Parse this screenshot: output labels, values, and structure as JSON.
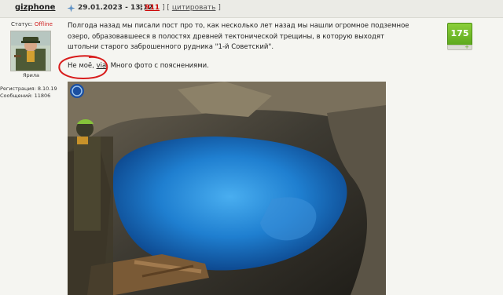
{
  "author": {
    "username": "gizphone",
    "status_label": "Статус:",
    "status_value": "Offline",
    "avatar_caption": "Ярила",
    "registration": "Регистрация: 8.10.19",
    "messages": "Сообщений: 11806"
  },
  "post": {
    "date": "29.01.2023 - 13:12",
    "bracket_open": "[",
    "number": "911",
    "bracket_mid": "] [",
    "quote_label": "цитировать",
    "bracket_close": "]",
    "body": "Полгода назад мы писали пост про то, как несколько лет назад мы нашли огромное подземное озеро, образовавшееся в полостях древней тектонической трещины, в которую выходят штольни старого заброшенного рудника \"1-й Советский\".",
    "line2_prefix": "Не моё, ",
    "line2_link": "via",
    "line2_suffix": ". Много фото с пояснениями.",
    "rating": "175",
    "rating_plus": "+"
  },
  "colors": {
    "background": "#f5f5f1",
    "rating_green": "#6cb82a",
    "offline_red": "#d02020",
    "annotation_red": "#d81c1c",
    "lake_blue": "#1f7fd0"
  }
}
